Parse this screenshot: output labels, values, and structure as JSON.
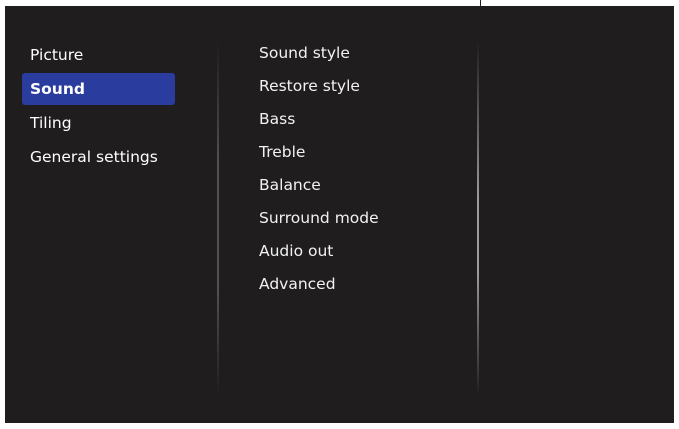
{
  "main_menu": {
    "items": [
      {
        "label": "Picture",
        "selected": false
      },
      {
        "label": "Sound",
        "selected": true
      },
      {
        "label": "Tiling",
        "selected": false
      },
      {
        "label": "General settings",
        "selected": false
      }
    ]
  },
  "sound_menu": {
    "items": [
      {
        "label": "Sound style"
      },
      {
        "label": "Restore style"
      },
      {
        "label": "Bass"
      },
      {
        "label": "Treble"
      },
      {
        "label": "Balance"
      },
      {
        "label": "Surround mode"
      },
      {
        "label": "Audio out"
      },
      {
        "label": "Advanced"
      }
    ]
  },
  "colors": {
    "background": "#1f1d1e",
    "highlight": "#2a3d9e",
    "text": "#ffffff"
  }
}
